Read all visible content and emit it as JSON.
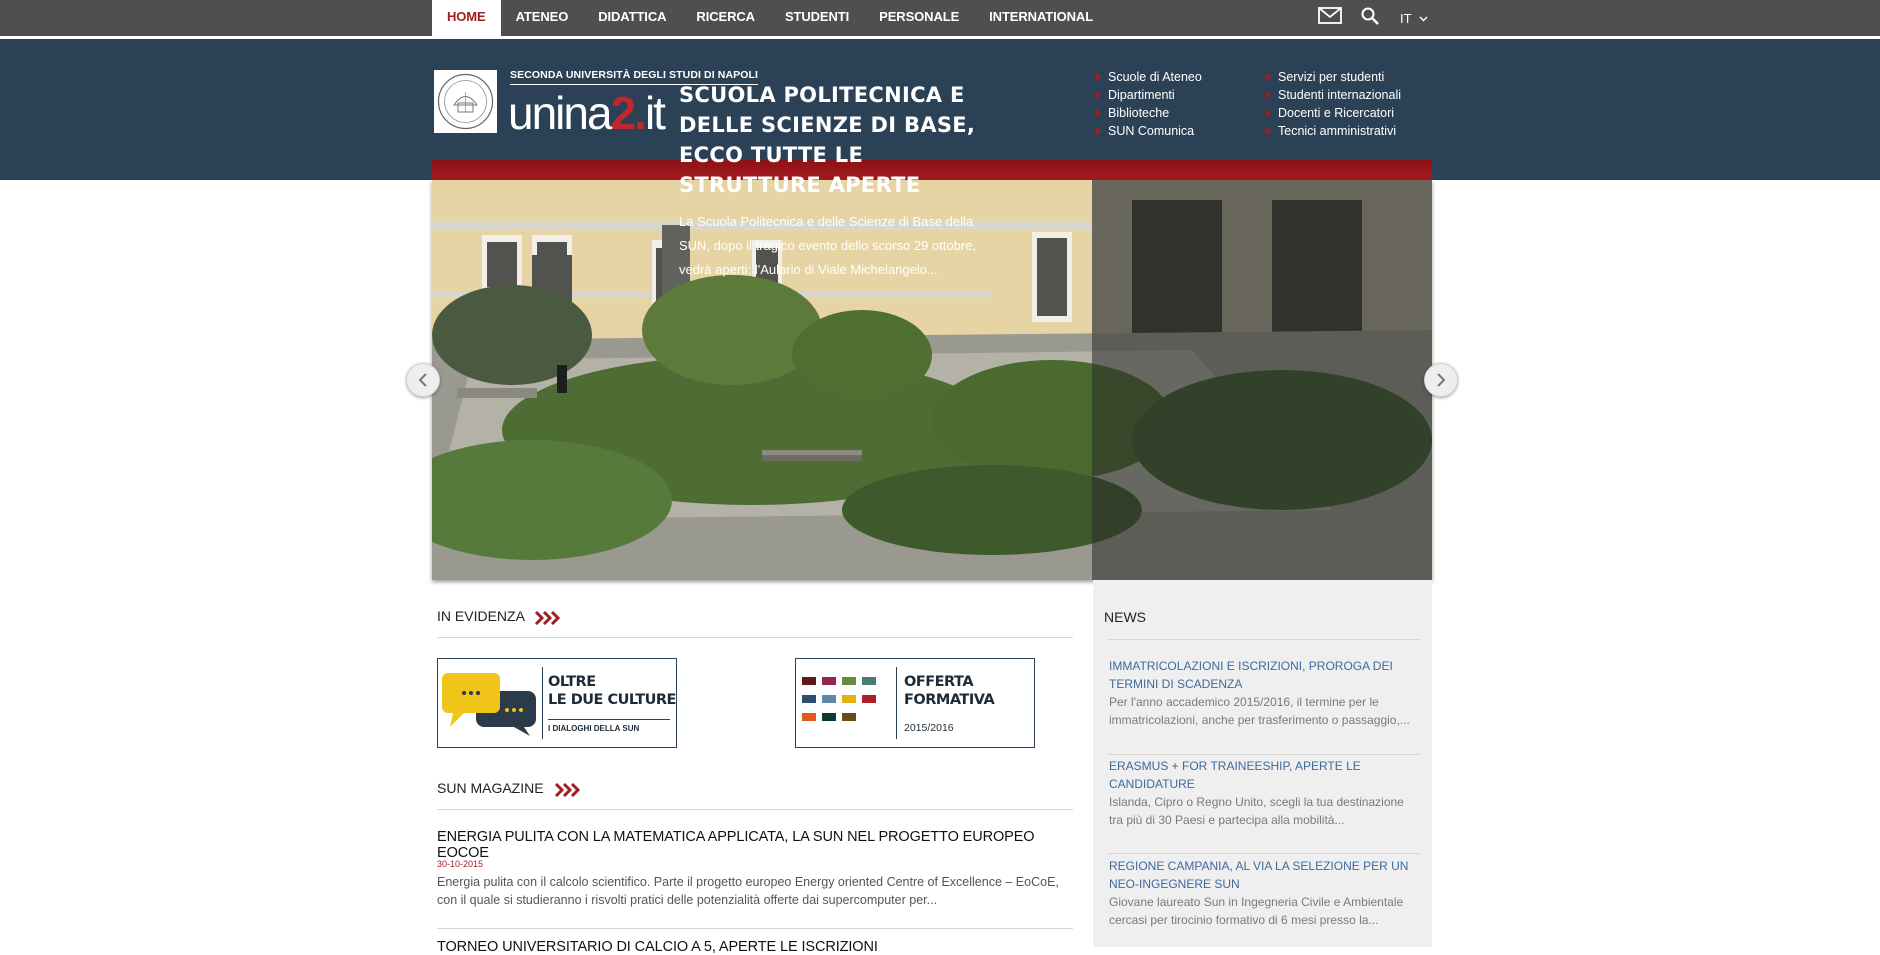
{
  "nav": {
    "items": [
      {
        "label": "HOME",
        "active": true
      },
      {
        "label": "ATENEO"
      },
      {
        "label": "DIDATTICA"
      },
      {
        "label": "RICERCA"
      },
      {
        "label": "STUDENTI"
      },
      {
        "label": "PERSONALE"
      },
      {
        "label": "INTERNATIONAL"
      }
    ],
    "lang": "IT",
    "icons": [
      "mail-icon",
      "search-icon",
      "chevron-down-icon"
    ]
  },
  "brand": {
    "subtitle": "SECONDA UNIVERSITÀ DEGLI STUDI DI NAPOLI",
    "name_prefix": "unina",
    "name_num": "2",
    "name_dot": ".",
    "name_suffix": "it",
    "accent": "#c1272d",
    "header_bg": "#2b4256"
  },
  "quicklinks": {
    "col1": [
      "Scuole di Ateneo",
      "Dipartimenti",
      "Biblioteche",
      "SUN Comunica"
    ],
    "col2": [
      "Servizi per studenti",
      "Studenti internazionali",
      "Docenti e Ricercatori",
      "Tecnici amministrativi"
    ]
  },
  "hero": {
    "title": "SCUOLA POLITECNICA E DELLE SCIENZE DI BASE, ECCO TUTTE LE STRUTTURE APERTE",
    "text": "La Scuola Politecnica e delle Scienze di Base della SUN, dopo il tragico evento dello scorso 29 ottobre, vedrà aperti: l'Aulario di Viale Michelangelo..."
  },
  "evidenza": {
    "title": "IN EVIDENZA",
    "promo1": {
      "line1": "OLTRE",
      "line2": "LE DUE CULTURE",
      "line3": "I DIALOGHI DELLA SUN"
    },
    "promo2": {
      "line1": "OFFERTA",
      "line2": "FORMATIVA",
      "line3": "2015/2016"
    }
  },
  "magazine": {
    "title": "SUN MAGAZINE",
    "articles": [
      {
        "title": "ENERGIA PULITA CON LA MATEMATICA APPLICATA, LA SUN NEL PROGETTO EUROPEO EOCOE",
        "date": "30-10-2015",
        "text1": "Energia pulita con il calcolo scientifico. Parte il progetto europeo Energy oriented Centre of Excellence – EoCoE,",
        "text2": "con il quale si studieranno i risvolti pratici delle potenzialità offerte dai supercomputer per..."
      },
      {
        "title": "TORNEO UNIVERSITARIO DI CALCIO A 5, APERTE LE ISCRIZIONI"
      }
    ]
  },
  "news": {
    "title": "NEWS",
    "items": [
      {
        "title1": "IMMATRICOLAZIONI E ISCRIZIONI, PROROGA DEI",
        "title2": "TERMINI DI SCADENZA",
        "desc1": "Per l'anno accademico 2015/2016, il termine per le",
        "desc2": "immatricolazioni, anche per trasferimento o passaggio,..."
      },
      {
        "title1": "ERASMUS + FOR TRAINEESHIP, APERTE LE",
        "title2": "CANDIDATURE",
        "desc1": "Islanda, Cipro o Regno Unito, scegli la tua destinazione",
        "desc2": "tra più di 30 Paesi e partecipa alla mobilità..."
      },
      {
        "title1": "REGIONE CAMPANIA, AL VIA LA SELEZIONE PER UN",
        "title2": "NEO-INGEGNERE SUN",
        "desc1": "Giovane laureato Sun in Ingegneria Civile e Ambientale",
        "desc2": "cercasi per tirocinio formativo di 6 mesi presso la..."
      }
    ]
  }
}
